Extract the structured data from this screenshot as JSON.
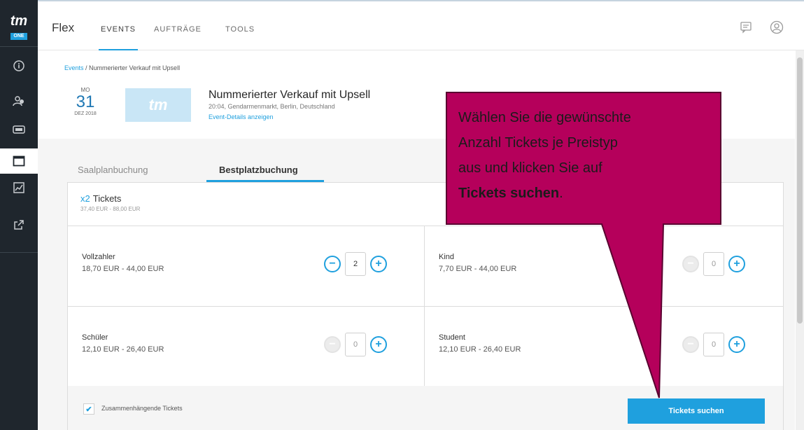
{
  "sidebar": {
    "logo_text": "tm",
    "logo_badge": "ONE",
    "items": [
      {
        "icon": "info-icon"
      },
      {
        "icon": "users-icon"
      },
      {
        "icon": "ticket-icon"
      },
      {
        "icon": "window-icon"
      },
      {
        "icon": "chart-icon"
      },
      {
        "icon": "external-link-icon"
      }
    ]
  },
  "topbar": {
    "app_name": "Flex",
    "tabs": [
      {
        "label": "EVENTS"
      },
      {
        "label": "AUFTRÄGE"
      },
      {
        "label": "TOOLS"
      }
    ],
    "icons": [
      "chat-icon",
      "user-icon"
    ]
  },
  "breadcrumb": {
    "link": "Events",
    "separator": " / ",
    "current": "Nummerierter Verkauf mit Upsell"
  },
  "event": {
    "dow": "MO",
    "day": "31",
    "month_year": "DEZ 2018",
    "image_text": "tm",
    "title": "Nummerierter Verkauf mit Upsell",
    "subtitle": "20:04, Gendarmenmarkt, Berlin, Deutschland",
    "details_link": "Event-Details anzeigen"
  },
  "booking_tabs": [
    {
      "label": "Saalplanbuchung"
    },
    {
      "label": "Bestplatzbuchung"
    }
  ],
  "tickets": {
    "count_prefix": "x2",
    "count_label": "Tickets",
    "range": "37,40 EUR - 88,00 EUR",
    "price_types": [
      {
        "name": "Vollzahler",
        "price": "18,70 EUR - 44,00 EUR",
        "qty": "2"
      },
      {
        "name": "Kind",
        "price": "7,70 EUR - 44,00 EUR",
        "qty": "0"
      },
      {
        "name": "Schüler",
        "price": "12,10 EUR - 26,40 EUR",
        "qty": "0"
      },
      {
        "name": "Student",
        "price": "12,10 EUR - 26,40 EUR",
        "qty": "0"
      }
    ],
    "minus_glyph": "−",
    "plus_glyph": "+"
  },
  "footer": {
    "checkbox_label": "Zusammenhängende Tickets",
    "checkbox_checked": true,
    "search_button": "Tickets suchen"
  },
  "callout": {
    "line1": "Wählen Sie die gewünschte",
    "line2": "Anzahl Tickets je Preistyp",
    "line3": "aus und klicken Sie auf",
    "bold": "Tickets suchen",
    "suffix": ".",
    "color": "#b5005b"
  },
  "colors": {
    "accent": "#1fa0de",
    "sidebar": "#1f262d"
  }
}
